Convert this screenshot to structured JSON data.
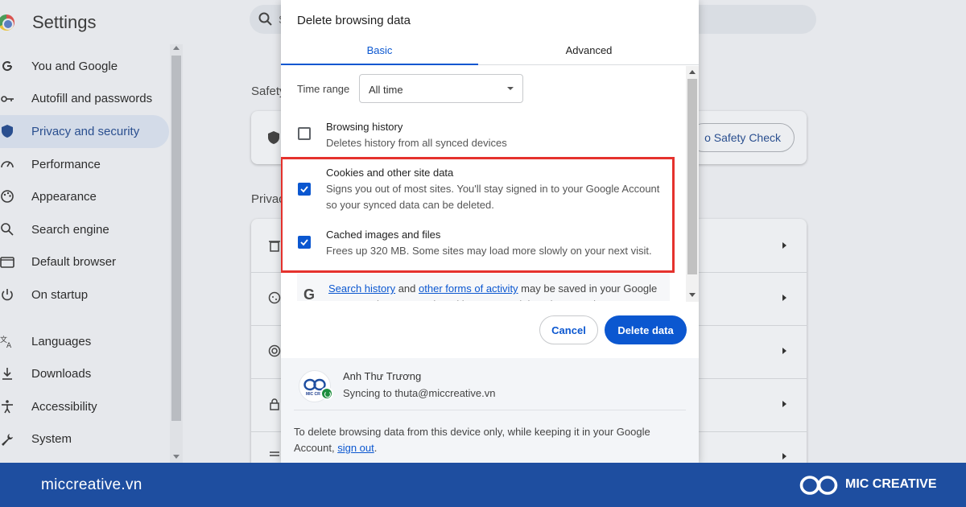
{
  "background": {
    "app_title": "Settings",
    "search_fragment": "S",
    "nav": [
      {
        "label": "You and Google",
        "icon": "google-g-icon"
      },
      {
        "label": "Autofill and passwords",
        "icon": "key-icon"
      },
      {
        "label": "Privacy and security",
        "icon": "shield-icon",
        "active": true
      },
      {
        "label": "Performance",
        "icon": "speedometer-icon"
      },
      {
        "label": "Appearance",
        "icon": "palette-icon"
      },
      {
        "label": "Search engine",
        "icon": "search-icon"
      },
      {
        "label": "Default browser",
        "icon": "browser-window-icon"
      },
      {
        "label": "On startup",
        "icon": "power-icon"
      },
      {
        "label": "Languages",
        "icon": "translate-icon"
      },
      {
        "label": "Downloads",
        "icon": "download-icon"
      },
      {
        "label": "Accessibility",
        "icon": "accessibility-icon"
      },
      {
        "label": "System",
        "icon": "wrench-icon"
      }
    ],
    "section_safety": "Safety",
    "section_privacy": "Privac",
    "safety_button": "o Safety Check"
  },
  "dialog": {
    "title": "Delete browsing data",
    "tabs": {
      "basic": "Basic",
      "advanced": "Advanced"
    },
    "time_range_label": "Time range",
    "time_range_value": "All time",
    "options": [
      {
        "title": "Browsing history",
        "desc": "Deletes history from all synced devices",
        "checked": false
      },
      {
        "title": "Cookies and other site data",
        "desc": "Signs you out of most sites. You'll stay signed in to your Google Account so your synced data can be deleted.",
        "checked": true
      },
      {
        "title": "Cached images and files",
        "desc": "Frees up 320 MB. Some sites may load more slowly on your next visit.",
        "checked": true
      }
    ],
    "info": {
      "g": "G",
      "link1": "Search history",
      "and": " and ",
      "link2": "other forms of activity",
      "rest": " may be saved in your Google Account when you're signed in. You can delete them anytime."
    },
    "buttons": {
      "cancel": "Cancel",
      "delete": "Delete data"
    },
    "account": {
      "name": "Anh Thư Trương",
      "sync": "Syncing to thuta@miccreative.vn",
      "avatar_text": "MIC CREA"
    },
    "footer_text": "To delete browsing data from this device only, while keeping it in your Google Account, ",
    "footer_link": "sign out",
    "footer_end": "."
  },
  "brand": {
    "url": "miccreative.vn",
    "name": "MIC CREATIVE"
  },
  "colors": {
    "accent": "#0b57d0",
    "highlight": "#e5322d",
    "brand_bar": "#1e4ea0"
  }
}
